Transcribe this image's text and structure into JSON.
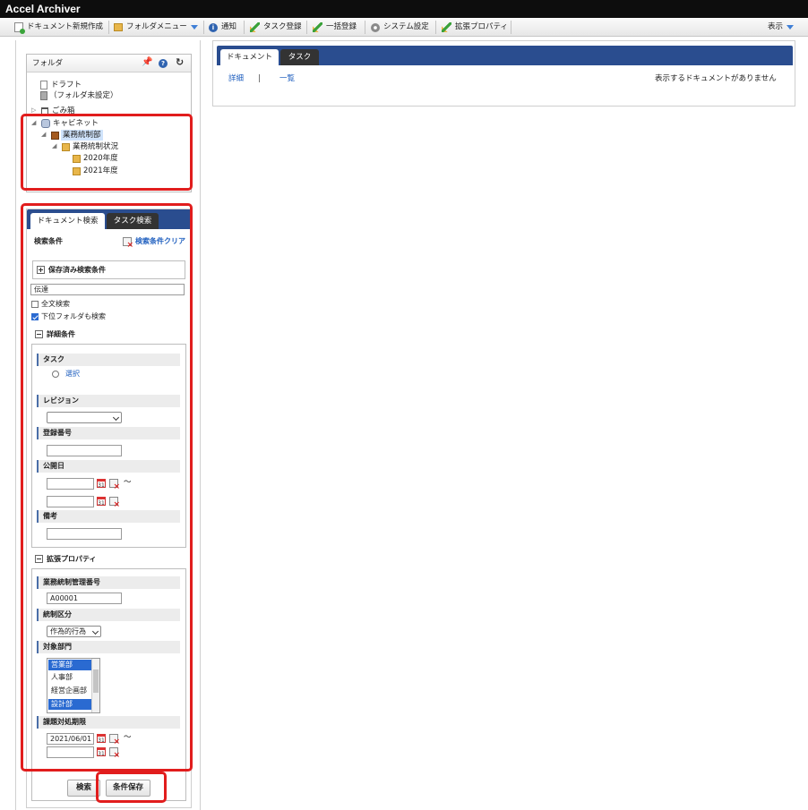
{
  "app": {
    "title": "Accel Archiver"
  },
  "toolbar": {
    "new_doc": "ドキュメント新規作成",
    "folder_menu": "フォルダメニュー",
    "notify": "通知",
    "task_register": "タスク登録",
    "bulk_register": "一括登録",
    "system_settings": "システム設定",
    "ext_properties": "拡張プロパティ",
    "view": "表示"
  },
  "folder_panel": {
    "title": "フォルダ",
    "tree": {
      "draft": "ドラフト",
      "draft_sub": "（フォルダ未設定）",
      "trash": "ごみ箱",
      "cabinet": "キャビネット",
      "dept": "業務統制部",
      "status": "業務統制状況",
      "y2020": "2020年度",
      "y2021": "2021年度"
    }
  },
  "search_panel": {
    "tab_doc": "ドキュメント検索",
    "tab_task": "タスク検索",
    "cond_label": "検索条件",
    "clear_label": "検索条件クリア",
    "saved_label": "保存済み検索条件",
    "keyword_value": "伝達",
    "fulltext_label": "全文検索",
    "fulltext_checked": false,
    "subfolder_label": "下位フォルダも検索",
    "subfolder_checked": true,
    "detail": {
      "title": "詳細条件",
      "task_label": "タスク",
      "select_link": "選択",
      "revision_label": "レビジョン",
      "revision_value": "",
      "regno_label": "登録番号",
      "regno_value": "",
      "pubdate_label": "公開日",
      "tilde": "～",
      "remarks_label": "備考",
      "remarks_value": ""
    },
    "ext": {
      "title": "拡張プロパティ",
      "ctrl_no_label": "業務統制管理番号",
      "ctrl_no_value": "A00001",
      "ctrl_type_label": "統制区分",
      "ctrl_type_value": "作為的行為",
      "dept_label": "対象部門",
      "dept_options": [
        "営業部",
        "人事部",
        "経営企画部",
        "設計部"
      ],
      "deadline_label": "課題対処期限",
      "deadline_from": "2021/06/01",
      "deadline_to": "",
      "tilde": "～"
    },
    "search_button": "検索",
    "save_button": "条件保存"
  },
  "main": {
    "tab_doc": "ドキュメント",
    "tab_task": "タスク",
    "detail_link": "詳細",
    "separator": "|",
    "list_link": "一覧",
    "empty_message": "表示するドキュメントがありません"
  },
  "colors": {
    "titlebar": "#0d0d0d",
    "tabbar": "#2a4d8f",
    "highlight": "#e11d1d",
    "link": "#1f5fbf"
  }
}
